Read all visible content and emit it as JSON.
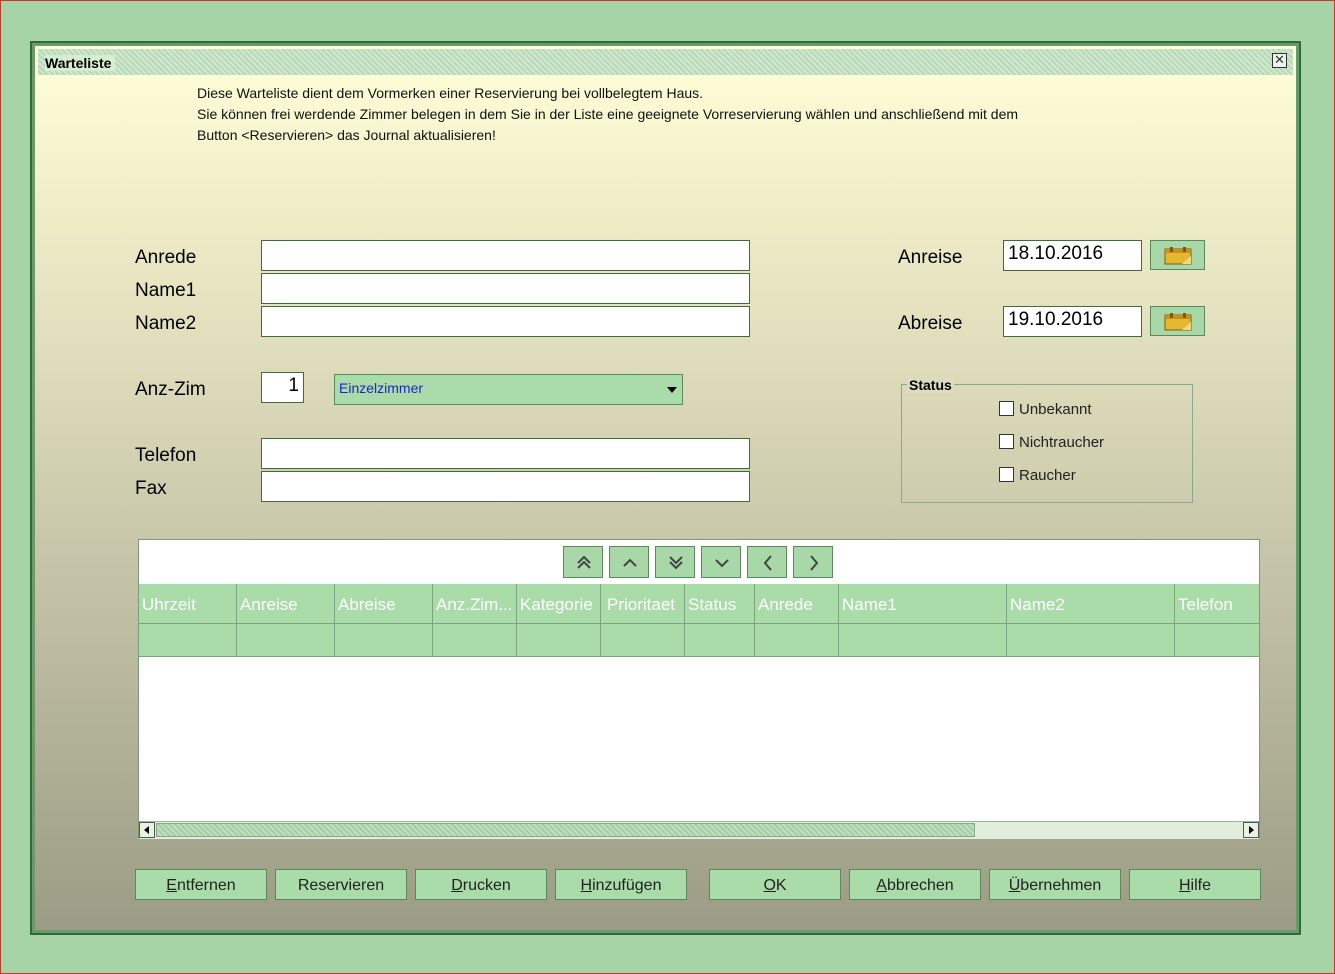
{
  "window": {
    "title": "Warteliste",
    "close_icon": "close-icon"
  },
  "info": {
    "line1": "Diese Warteliste dient dem Vormerken einer Reservierung bei vollbelegtem Haus.",
    "line2": "Sie können frei werdende Zimmer belegen in dem Sie in der Liste eine geeignete Vorreservierung wählen und anschließend mit dem",
    "line3": "Button <Reservieren> das Journal aktualisieren!"
  },
  "form": {
    "anrede_label": "Anrede",
    "anrede_value": "",
    "name1_label": "Name1",
    "name1_value": "",
    "name2_label": "Name2",
    "name2_value": "",
    "anzzim_label": "Anz-Zim",
    "anzzim_value": "1",
    "room_type": "Einzelzimmer",
    "telefon_label": "Telefon",
    "telefon_value": "",
    "fax_label": "Fax",
    "fax_value": "",
    "anreise_label": "Anreise",
    "anreise_value": "18.10.2016",
    "abreise_label": "Abreise",
    "abreise_value": "19.10.2016"
  },
  "status": {
    "title": "Status",
    "options": [
      {
        "label": "Unbekannt",
        "checked": false
      },
      {
        "label": "Nichtraucher",
        "checked": false
      },
      {
        "label": "Raucher",
        "checked": false
      }
    ]
  },
  "grid": {
    "nav_icons": [
      "first-icon",
      "prev-page-icon",
      "last-icon",
      "next-page-icon",
      "prev-icon",
      "next-icon"
    ],
    "columns": [
      "Uhrzeit",
      "Anreise",
      "Abreise",
      "Anz.Zim...",
      "Kategorie",
      "Prioritaet",
      "Status",
      "Anrede",
      "Name1",
      "Name2",
      "Telefon"
    ]
  },
  "buttons": {
    "entfernen": {
      "pre": "",
      "u": "E",
      "post": "ntfernen"
    },
    "reservieren": {
      "pre": "Reservieren",
      "u": "",
      "post": ""
    },
    "drucken": {
      "pre": "",
      "u": "D",
      "post": "rucken"
    },
    "hinzufuegen": {
      "pre": "",
      "u": "H",
      "post": "inzufügen"
    },
    "ok": {
      "pre": "",
      "u": "O",
      "post": "K"
    },
    "abbrechen": {
      "pre": "",
      "u": "A",
      "post": "bbrechen"
    },
    "uebernehmen": {
      "pre": "",
      "u": "Ü",
      "post": "bernehmen"
    },
    "hilfe": {
      "pre": "",
      "u": "H",
      "post": "ilfe"
    }
  },
  "colors": {
    "accent_green": "#a9dca9",
    "border_green": "#2e6b3a",
    "combo_text": "#2222cc"
  }
}
